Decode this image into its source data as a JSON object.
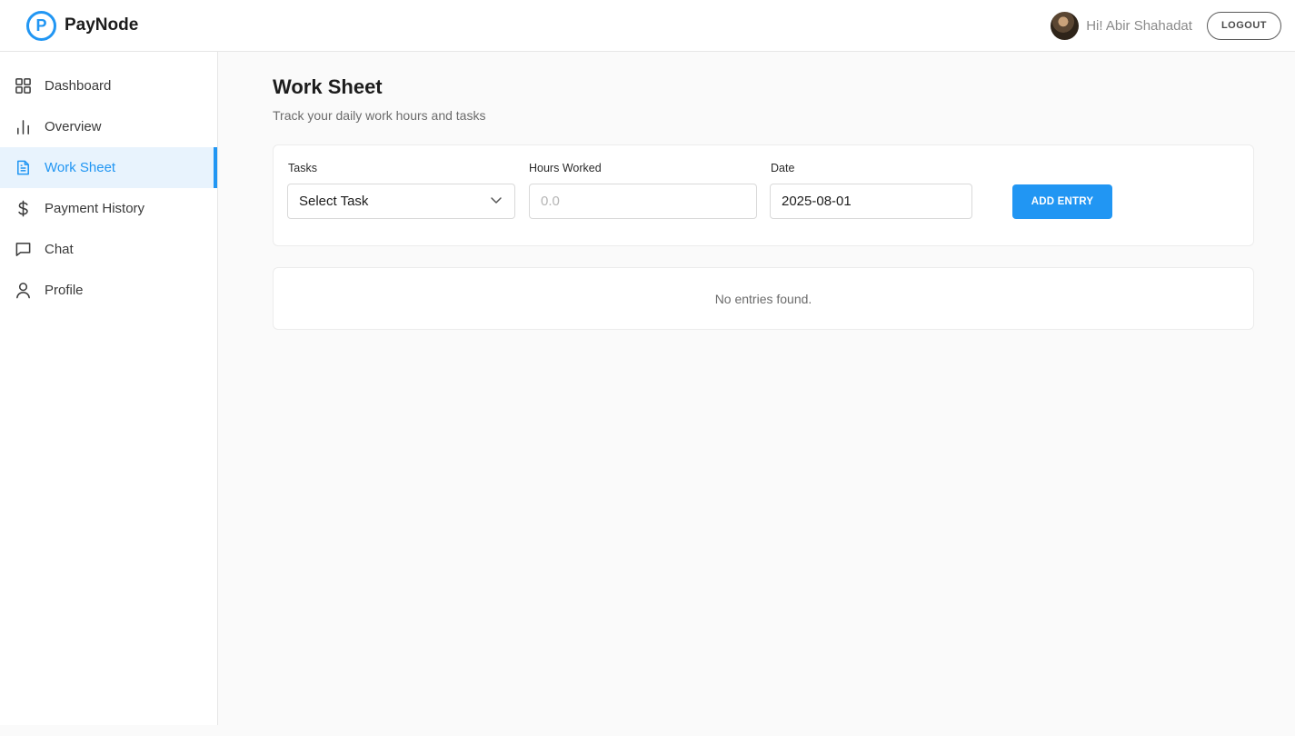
{
  "app": {
    "brand_letter": "P",
    "brand_name": "PayNode"
  },
  "header": {
    "greeting": "Hi! Abir Shahadat",
    "logout_label": "LOGOUT"
  },
  "sidebar": {
    "items": [
      {
        "label": "Dashboard",
        "icon": "grid-icon",
        "active": false
      },
      {
        "label": "Overview",
        "icon": "bar-chart-icon",
        "active": false
      },
      {
        "label": "Work Sheet",
        "icon": "document-icon",
        "active": true
      },
      {
        "label": "Payment History",
        "icon": "dollar-icon",
        "active": false
      },
      {
        "label": "Chat",
        "icon": "chat-icon",
        "active": false
      },
      {
        "label": "Profile",
        "icon": "user-icon",
        "active": false
      }
    ]
  },
  "main": {
    "title": "Work Sheet",
    "subtitle": "Track your daily work hours and tasks",
    "form": {
      "task_label": "Tasks",
      "task_value": "Select Task",
      "hours_label": "Hours Worked",
      "hours_placeholder": "0.0",
      "date_label": "Date",
      "date_value": "2025-08-01",
      "add_label": "ADD ENTRY"
    },
    "empty_message": "No entries found."
  },
  "colors": {
    "accent": "#2196f3",
    "active_bg": "#e8f3fd"
  }
}
